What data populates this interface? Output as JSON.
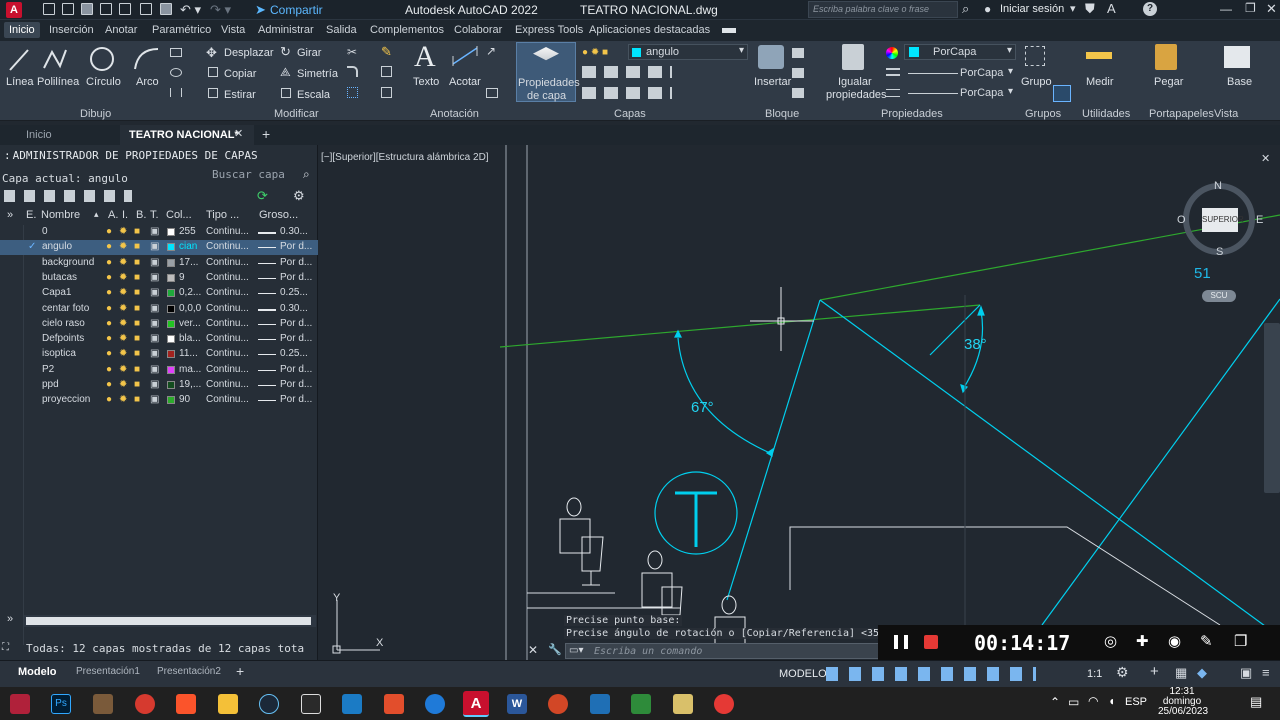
{
  "titlebar": {
    "app": "Autodesk AutoCAD 2022",
    "file": "TEATRO NACIONAL.dwg",
    "share": "Compartir",
    "search_placeholder": "Escriba palabra clave o frase",
    "login": "Iniciar sesión"
  },
  "menu_tabs": [
    "Inicio",
    "Inserción",
    "Anotar",
    "Paramétrico",
    "Vista",
    "Administrar",
    "Salida",
    "Complementos",
    "Colaborar",
    "Express Tools",
    "Aplicaciones destacadas"
  ],
  "ribbon": {
    "draw": {
      "linea": "Línea",
      "polilinea": "Polilínea",
      "circulo": "Círculo",
      "arco": "Arco",
      "title": "Dibujo"
    },
    "modify": {
      "desplazar": "Desplazar",
      "girar": "Girar",
      "copiar": "Copiar",
      "simetria": "Simetría",
      "estirar": "Estirar",
      "escala": "Escala",
      "title": "Modificar"
    },
    "annotation": {
      "texto": "Texto",
      "acotar": "Acotar",
      "title": "Anotación"
    },
    "layers": {
      "props_line1": "Propiedades",
      "props_line2": "de capa",
      "current": "angulo",
      "title": "Capas"
    },
    "block": {
      "insertar": "Insertar",
      "title": "Bloque"
    },
    "properties": {
      "igualar1": "Igualar",
      "igualar2": "propiedades",
      "porcapa1": "PorCapa",
      "porcapa2": "PorCapa",
      "porcapa3": "PorCapa",
      "title": "Propiedades"
    },
    "groups": {
      "grupo": "Grupo",
      "title": "Grupos"
    },
    "utilities": {
      "medir": "Medir",
      "title": "Utilidades"
    },
    "clipboard": {
      "pegar": "Pegar",
      "title": "Portapapeles"
    },
    "view": {
      "base": "Base",
      "title": "Vista"
    }
  },
  "doc_tabs": {
    "inicio": "Inicio",
    "active": "TEATRO NACIONAL*"
  },
  "layer_panel": {
    "title": "ADMINISTRADOR DE PROPIEDADES DE CAPAS",
    "current": "Capa actual: angulo",
    "search": "Buscar capa",
    "headers": {
      "e": "E.",
      "nombre": "Nombre",
      "a": "A.",
      "i": "I.",
      "b": "B.",
      "t": "T.",
      "color": "Col...",
      "tipo": "Tipo ...",
      "grosor": "Groso..."
    },
    "rows": [
      {
        "name": "0",
        "color": "255",
        "swatch": "#ffffff",
        "type": "Continu...",
        "weight": "0.30...",
        "thick": true
      },
      {
        "name": "angulo",
        "color": "cian",
        "swatch": "#00e5ff",
        "type": "Continu...",
        "weight": "Por d...",
        "thick": false
      },
      {
        "name": "background",
        "color": "17...",
        "swatch": "#9aa0a6",
        "type": "Continu...",
        "weight": "Por d...",
        "thick": false
      },
      {
        "name": "butacas",
        "color": "9",
        "swatch": "#bdbdbd",
        "type": "Continu...",
        "weight": "Por d...",
        "thick": false
      },
      {
        "name": "Capa1",
        "color": "0,2...",
        "swatch": "#1faa3b",
        "type": "Continu...",
        "weight": "0.25...",
        "thick": false
      },
      {
        "name": "centar foto",
        "color": "0,0,0",
        "swatch": "#000000",
        "type": "Continu...",
        "weight": "0.30...",
        "thick": true
      },
      {
        "name": "cielo raso",
        "color": "ver...",
        "swatch": "#22c322",
        "type": "Continu...",
        "weight": "Por d...",
        "thick": false
      },
      {
        "name": "Defpoints",
        "color": "bla...",
        "swatch": "#ffffff",
        "type": "Continu...",
        "weight": "Por d...",
        "thick": false
      },
      {
        "name": "isoptica",
        "color": "11...",
        "swatch": "#a3231f",
        "type": "Continu...",
        "weight": "0.25...",
        "thick": false
      },
      {
        "name": "P2",
        "color": "ma...",
        "swatch": "#e040fb",
        "type": "Continu...",
        "weight": "Por d...",
        "thick": false
      },
      {
        "name": "ppd",
        "color": "19,...",
        "swatch": "#134d1f",
        "type": "Continu...",
        "weight": "Por d...",
        "thick": false
      },
      {
        "name": "proyeccion",
        "color": "90",
        "swatch": "#2cab2c",
        "type": "Continu...",
        "weight": "Por d...",
        "thick": false
      }
    ],
    "footer": "Todas: 12 capas mostradas de 12 capas tota"
  },
  "canvas": {
    "viewport_label": "[−][Superior][Estructura alámbrica 2D]",
    "angle1": "67°",
    "angle2": "38°",
    "text_mark": "T",
    "viewcube": {
      "n": "N",
      "s": "S",
      "o": "O",
      "e": "E",
      "face": "SUPERIOR",
      "scu": "SCU",
      "num": "51"
    },
    "cmd_line1": "Precise punto base:",
    "cmd_line2": "Precise ángulo de rotación o [Copiar/Referencia] <35",
    "cmd_placeholder": "Escriba un comando",
    "ucs_x": "X",
    "ucs_y": "Y"
  },
  "recorder": {
    "time": "00:14:17"
  },
  "status": {
    "tabs": [
      "Modelo",
      "Presentación1",
      "Presentación2"
    ],
    "modelo": "MODELO",
    "scale": "1:1",
    "lang": "ESP",
    "time": "12:31",
    "day": "domingo",
    "date": "25/06/2023"
  },
  "colors": {
    "accent": "#00d8ff",
    "green_line": "#2ea82e",
    "selection": "#3d5e80"
  }
}
